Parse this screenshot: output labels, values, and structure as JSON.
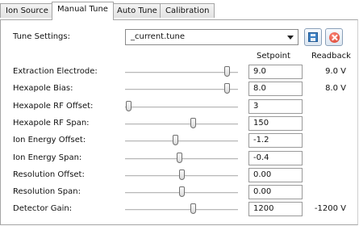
{
  "tabs": [
    {
      "label": "Ion Source",
      "active": false
    },
    {
      "label": "Manual Tune",
      "active": true
    },
    {
      "label": "Auto Tune",
      "active": false
    },
    {
      "label": "Calibration",
      "active": false
    }
  ],
  "tune_settings": {
    "label": "Tune Settings:",
    "selected_file": "_current.tune",
    "save_icon": "save-disk-icon",
    "cancel_icon": "red-x-icon"
  },
  "columns": {
    "setpoint": "Setpoint",
    "readback": "Readback"
  },
  "rows": [
    {
      "label": "Extraction Electrode:",
      "slider_fraction": 0.9,
      "setpoint": "9.0",
      "readback": "9.0 V"
    },
    {
      "label": "Hexapole Bias:",
      "slider_fraction": 0.9,
      "setpoint": "8.0",
      "readback": "8.0 V"
    },
    {
      "label": "Hexapole RF Offset:",
      "slider_fraction": 0.03,
      "setpoint": "3",
      "readback": ""
    },
    {
      "label": "Hexapole RF Span:",
      "slider_fraction": 0.6,
      "setpoint": "150",
      "readback": ""
    },
    {
      "label": "Ion Energy Offset:",
      "slider_fraction": 0.44,
      "setpoint": "-1.2",
      "readback": ""
    },
    {
      "label": "Ion Energy Span:",
      "slider_fraction": 0.48,
      "setpoint": "-0.4",
      "readback": ""
    },
    {
      "label": "Resolution Offset:",
      "slider_fraction": 0.5,
      "setpoint": "0.00",
      "readback": ""
    },
    {
      "label": "Resolution Span:",
      "slider_fraction": 0.5,
      "setpoint": "0.00",
      "readback": ""
    },
    {
      "label": "Detector Gain:",
      "slider_fraction": 0.6,
      "setpoint": "1200",
      "readback": "-1200 V"
    }
  ]
}
